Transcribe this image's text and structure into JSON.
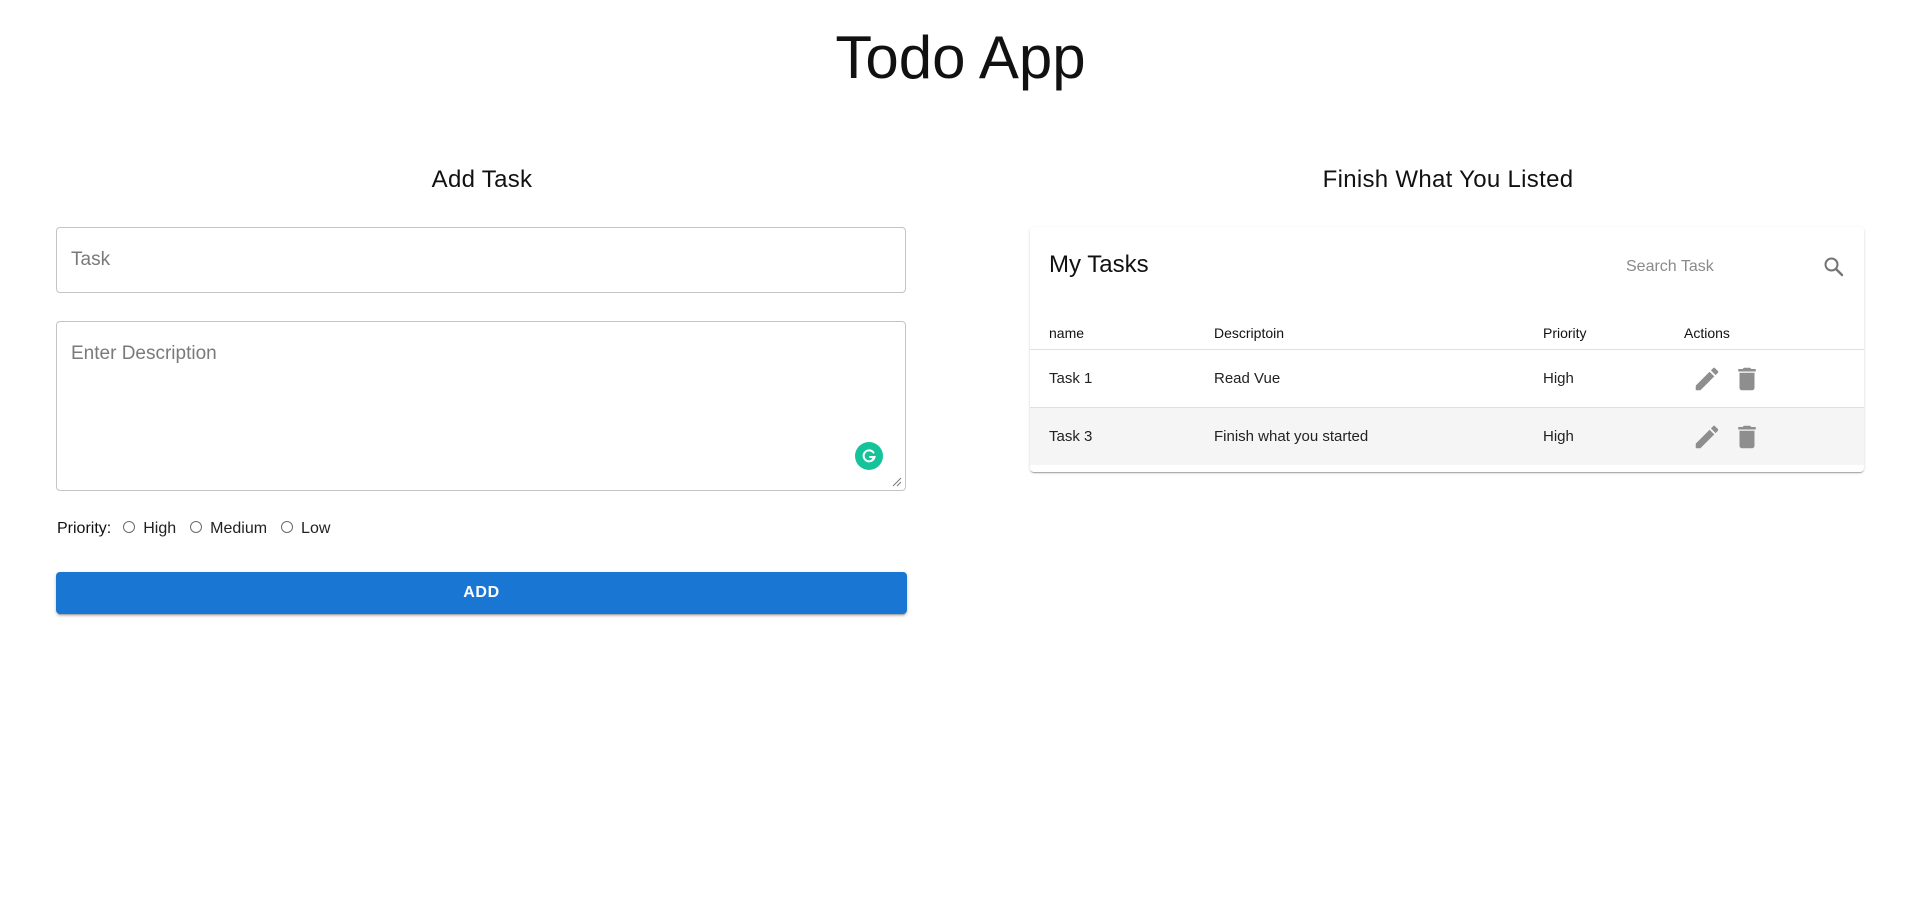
{
  "app": {
    "title": "Todo App"
  },
  "add_task": {
    "heading": "Add Task",
    "task_placeholder": "Task",
    "description_placeholder": "Enter Description",
    "priority_label": "Priority:",
    "priority_options": [
      "High",
      "Medium",
      "Low"
    ],
    "add_button": "ADD"
  },
  "task_list": {
    "heading": "Finish What You Listed",
    "card_title": "My Tasks",
    "search_placeholder": "Search Task",
    "columns": [
      "name",
      "Descriptoin",
      "Priority",
      "Actions"
    ],
    "rows": [
      {
        "name": "Task 1",
        "description": "Read Vue",
        "priority": "High"
      },
      {
        "name": "Task 3",
        "description": "Finish what you started",
        "priority": "High"
      }
    ]
  },
  "colors": {
    "primary": "#1976d2",
    "icon_gray": "#8e8e8e",
    "grammarly": "#15c39a"
  }
}
